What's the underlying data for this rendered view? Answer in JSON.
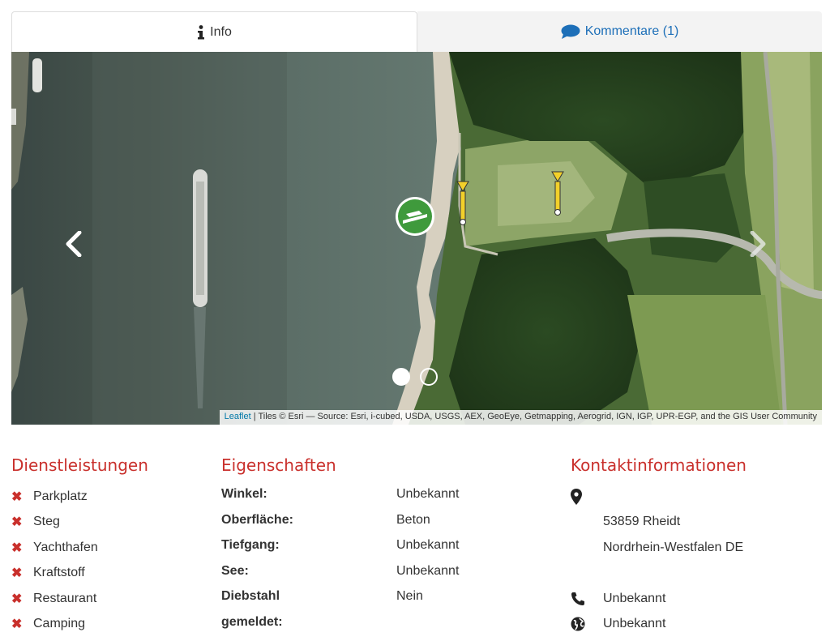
{
  "tabs": [
    {
      "label": "Info",
      "icon": "info-icon",
      "active": true
    },
    {
      "label": "Kommentare (1)",
      "icon": "comment-icon",
      "active": false
    }
  ],
  "map": {
    "attribution_link": "Leaflet",
    "attribution_text": " | Tiles © Esri — Source: Esri, i-cubed, USDA, USGS, AEX, GeoEye, Getmapping, Aerogrid, IGN, IGP, UPR-EGP, and the GIS User Community",
    "carousel_slides": 2,
    "active_slide": 1
  },
  "services": {
    "heading": "Dienstleistungen",
    "items": [
      "Parkplatz",
      "Steg",
      "Yachthafen",
      "Kraftstoff",
      "Restaurant",
      "Camping"
    ]
  },
  "properties": {
    "heading": "Eigenschaften",
    "rows": [
      {
        "label": "Winkel:",
        "value": "Unbekannt"
      },
      {
        "label": "Oberfläche:",
        "value": "Beton"
      },
      {
        "label": "Tiefgang:",
        "value": "Unbekannt"
      },
      {
        "label": "See:",
        "value": "Unbekannt"
      },
      {
        "label": "Diebstahl",
        "value": "Nein"
      },
      {
        "label": "gemeldet:",
        "value": ""
      }
    ]
  },
  "contact": {
    "heading": "Kontaktinformationen",
    "address_line1": "",
    "address_line2": "53859 Rheidt",
    "address_line3": "Nordrhein-Westfalen DE",
    "phone": "Unbekannt",
    "website": "Unbekannt"
  },
  "colors": {
    "accent_red": "#c9302c",
    "link_blue": "#1d6fb8"
  }
}
